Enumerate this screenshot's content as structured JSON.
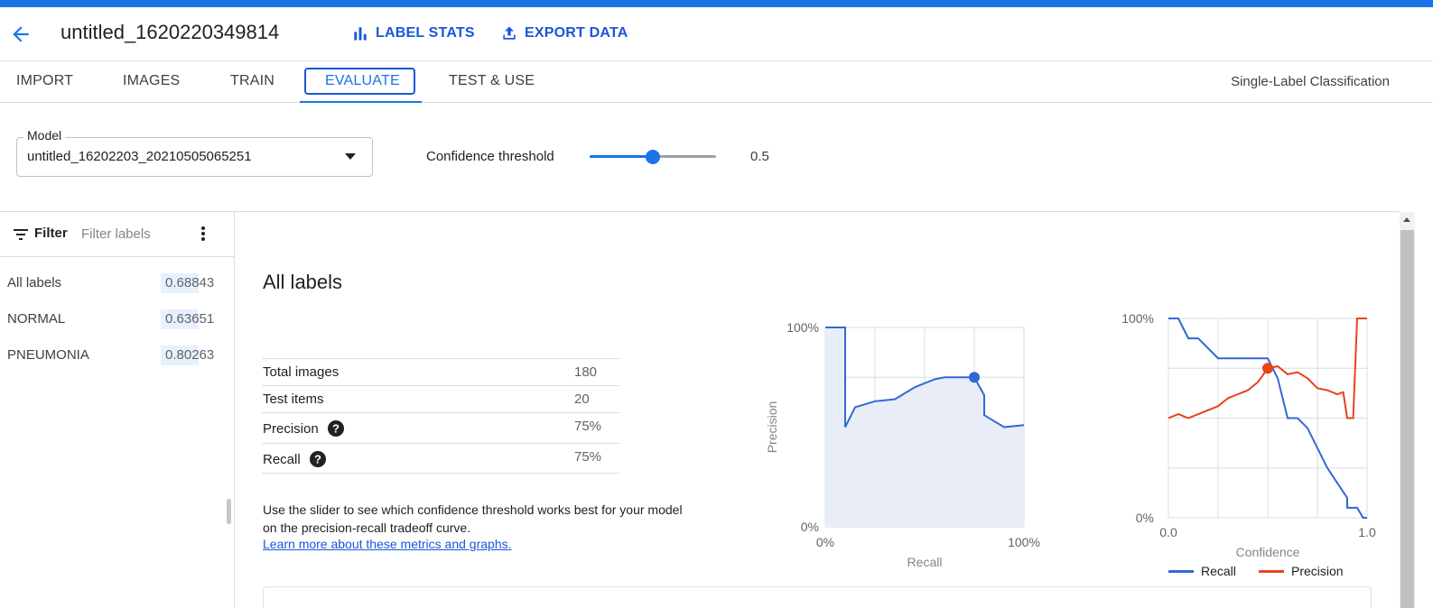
{
  "header": {
    "title": "untitled_1620220349814",
    "actions": [
      {
        "label": "LABEL STATS",
        "icon": "bar-chart-icon"
      },
      {
        "label": "EXPORT DATA",
        "icon": "upload-icon"
      }
    ]
  },
  "tabs": [
    "IMPORT",
    "IMAGES",
    "TRAIN",
    "EVALUATE",
    "TEST & USE"
  ],
  "active_tab": "EVALUATE",
  "problem_type": "Single-Label Classification",
  "model_select": {
    "label": "Model",
    "value": "untitled_16202203_20210505065251"
  },
  "confidence": {
    "label": "Confidence threshold",
    "value": "0.5",
    "fraction": 0.5
  },
  "sidebar": {
    "filter_title": "Filter",
    "filter_placeholder": "Filter labels",
    "labels": [
      {
        "name": "All labels",
        "score": "0.68843"
      },
      {
        "name": "NORMAL",
        "score": "0.63651"
      },
      {
        "name": "PNEUMONIA",
        "score": "0.80263"
      }
    ]
  },
  "main": {
    "title": "All labels",
    "metrics": [
      {
        "name": "Total images",
        "value": "180",
        "help": false
      },
      {
        "name": "Test items",
        "value": "20",
        "help": false
      },
      {
        "name": "Precision",
        "value": "75%",
        "help": true
      },
      {
        "name": "Recall",
        "value": "75%",
        "help": true
      }
    ],
    "info_text": "Use the slider to see which confidence threshold works best for your model on the precision-recall tradeoff curve.",
    "info_link": "Learn more about these metrics and graphs."
  },
  "colors": {
    "accent": "#1a73e8",
    "recall_line": "#3367d6",
    "precision_line": "#e8431a"
  },
  "chart_data": [
    {
      "type": "area",
      "xlabel": "Recall",
      "ylabel": "Precision",
      "x_ticks": [
        "0%",
        "100%"
      ],
      "y_ticks": [
        "0%",
        "100%"
      ],
      "xlim": [
        0,
        1
      ],
      "ylim": [
        0,
        1
      ],
      "grid": true,
      "points": [
        [
          0,
          1.0
        ],
        [
          0.1,
          1.0
        ],
        [
          0.1,
          0.5
        ],
        [
          0.15,
          0.6
        ],
        [
          0.25,
          0.63
        ],
        [
          0.35,
          0.64
        ],
        [
          0.45,
          0.7
        ],
        [
          0.55,
          0.74
        ],
        [
          0.6,
          0.75
        ],
        [
          0.7,
          0.75
        ],
        [
          0.75,
          0.75
        ],
        [
          0.8,
          0.66
        ],
        [
          0.8,
          0.56
        ],
        [
          0.9,
          0.5
        ],
        [
          1.0,
          0.51
        ]
      ],
      "highlight": [
        0.75,
        0.75
      ]
    },
    {
      "type": "line",
      "xlabel": "Confidence",
      "x_ticks": [
        "0.0",
        "1.0"
      ],
      "y_ticks": [
        "0%",
        "100%"
      ],
      "xlim": [
        0,
        1
      ],
      "ylim": [
        0,
        1
      ],
      "grid": true,
      "legend_position": "bottom",
      "series": [
        {
          "name": "Recall",
          "points": [
            [
              0,
              1.0
            ],
            [
              0.05,
              1.0
            ],
            [
              0.1,
              0.9
            ],
            [
              0.15,
              0.9
            ],
            [
              0.25,
              0.8
            ],
            [
              0.4,
              0.8
            ],
            [
              0.5,
              0.8
            ],
            [
              0.55,
              0.7
            ],
            [
              0.6,
              0.5
            ],
            [
              0.65,
              0.5
            ],
            [
              0.7,
              0.45
            ],
            [
              0.8,
              0.25
            ],
            [
              0.9,
              0.1
            ],
            [
              0.9,
              0.05
            ],
            [
              0.95,
              0.05
            ],
            [
              0.98,
              0.0
            ],
            [
              1.0,
              0.0
            ]
          ]
        },
        {
          "name": "Precision",
          "points": [
            [
              0,
              0.5
            ],
            [
              0.05,
              0.52
            ],
            [
              0.1,
              0.5
            ],
            [
              0.2,
              0.54
            ],
            [
              0.25,
              0.56
            ],
            [
              0.3,
              0.6
            ],
            [
              0.35,
              0.62
            ],
            [
              0.4,
              0.64
            ],
            [
              0.45,
              0.68
            ],
            [
              0.5,
              0.75
            ],
            [
              0.55,
              0.76
            ],
            [
              0.6,
              0.72
            ],
            [
              0.65,
              0.73
            ],
            [
              0.7,
              0.7
            ],
            [
              0.75,
              0.65
            ],
            [
              0.8,
              0.64
            ],
            [
              0.85,
              0.62
            ],
            [
              0.88,
              0.63
            ],
            [
              0.9,
              0.5
            ],
            [
              0.93,
              0.5
            ],
            [
              0.95,
              1.0
            ],
            [
              1.0,
              1.0
            ]
          ]
        }
      ],
      "highlight": [
        0.5,
        0.75
      ]
    }
  ]
}
